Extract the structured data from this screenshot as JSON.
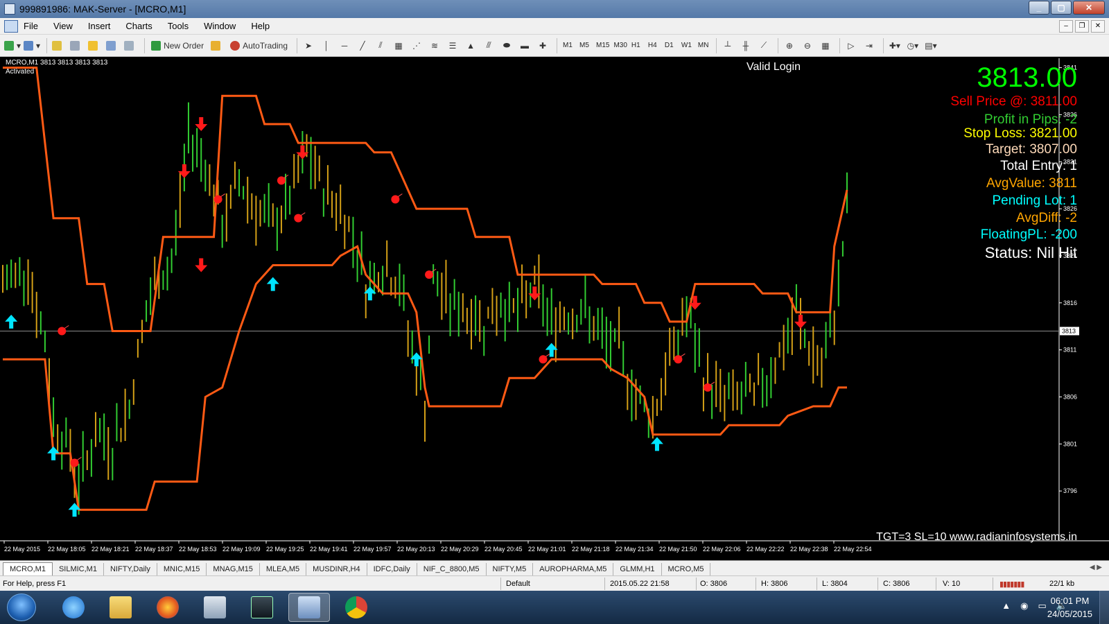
{
  "window": {
    "title": "999891986: MAK-Server - [MCRO,M1]"
  },
  "menu": [
    "File",
    "View",
    "Insert",
    "Charts",
    "Tools",
    "Window",
    "Help"
  ],
  "toolbar": {
    "new_order": "New Order",
    "autotrading": "AutoTrading",
    "timeframes": [
      "M1",
      "M5",
      "M15",
      "M30",
      "H1",
      "H4",
      "D1",
      "W1",
      "MN"
    ]
  },
  "chart": {
    "symbol_label": "MCRO,M1",
    "ohlc_label": "3813 3813 3813 3813",
    "activated_label": "Activated",
    "valid_login": "Valid Login",
    "current_price_label": "3813",
    "footer_note": "TGT=3 SL=10 www.radianinfosystems.in",
    "info_panel": [
      {
        "text": "3813.00",
        "color": "#00ff00",
        "size": 40
      },
      {
        "text": "Sell Price @: 3811.00",
        "color": "#ff0000",
        "size": 19
      },
      {
        "text": "Profit in Pips: -2",
        "color": "#32cd32",
        "size": 19
      },
      {
        "text": "Stop Loss: 3821.00",
        "color": "#ffff00",
        "size": 19
      },
      {
        "text": "Target: 3807.00",
        "color": "#ffdab9",
        "size": 19
      },
      {
        "text": "Total Entry: 1",
        "color": "#ffffff",
        "size": 19
      },
      {
        "text": "AvgValue: 3811",
        "color": "#ffa500",
        "size": 19
      },
      {
        "text": "Pending Lot: 1",
        "color": "#00ffff",
        "size": 19
      },
      {
        "text": "AvgDiff: -2",
        "color": "#ffa500",
        "size": 19
      },
      {
        "text": "FloatingPL: -200",
        "color": "#00ffff",
        "size": 19
      },
      {
        "text": "Status: Nil Hit",
        "color": "#ffffff",
        "size": 22
      }
    ]
  },
  "chart_data": {
    "type": "bar",
    "ylim": [
      3791,
      3842
    ],
    "y_ticks": [
      3841,
      3836,
      3831,
      3826,
      3821,
      3816,
      3811,
      3806,
      3801,
      3796
    ],
    "current_price": 3813,
    "x_ticks": [
      "22 May 2015",
      "22 May 18:05",
      "22 May 18:21",
      "22 May 18:37",
      "22 May 18:53",
      "22 May 19:09",
      "22 May 19:25",
      "22 May 19:41",
      "22 May 19:57",
      "22 May 20:13",
      "22 May 20:29",
      "22 May 20:45",
      "22 May 21:01",
      "22 May 21:18",
      "22 May 21:34",
      "22 May 21:50",
      "22 May 22:06",
      "22 May 22:22",
      "22 May 22:38",
      "22 May 22:54"
    ],
    "upper_band": [
      [
        0,
        3841
      ],
      [
        8,
        3841
      ],
      [
        12,
        3825
      ],
      [
        18,
        3825
      ],
      [
        20,
        3818
      ],
      [
        24,
        3818
      ],
      [
        26,
        3813
      ],
      [
        35,
        3813
      ],
      [
        38,
        3823
      ],
      [
        50,
        3823
      ],
      [
        52,
        3838
      ],
      [
        60,
        3838
      ],
      [
        62,
        3835
      ],
      [
        68,
        3835
      ],
      [
        70,
        3833
      ],
      [
        86,
        3833
      ],
      [
        88,
        3832
      ],
      [
        92,
        3832
      ],
      [
        94,
        3830
      ],
      [
        98,
        3826
      ],
      [
        110,
        3826
      ],
      [
        112,
        3823
      ],
      [
        120,
        3823
      ],
      [
        122,
        3819
      ],
      [
        140,
        3819
      ],
      [
        142,
        3818
      ],
      [
        150,
        3818
      ],
      [
        152,
        3816
      ],
      [
        156,
        3816
      ],
      [
        158,
        3814
      ],
      [
        162,
        3814
      ],
      [
        164,
        3818
      ],
      [
        178,
        3818
      ],
      [
        180,
        3817
      ],
      [
        186,
        3817
      ],
      [
        188,
        3815
      ],
      [
        196,
        3815
      ],
      [
        197,
        3822
      ],
      [
        200,
        3828
      ]
    ],
    "lower_band": [
      [
        0,
        3810
      ],
      [
        10,
        3810
      ],
      [
        12,
        3800
      ],
      [
        16,
        3800
      ],
      [
        18,
        3794
      ],
      [
        34,
        3794
      ],
      [
        36,
        3797
      ],
      [
        46,
        3797
      ],
      [
        48,
        3806
      ],
      [
        52,
        3807
      ],
      [
        56,
        3813
      ],
      [
        60,
        3818
      ],
      [
        64,
        3820
      ],
      [
        78,
        3820
      ],
      [
        80,
        3821
      ],
      [
        84,
        3822
      ],
      [
        86,
        3819
      ],
      [
        90,
        3817
      ],
      [
        96,
        3817
      ],
      [
        98,
        3815
      ],
      [
        100,
        3807
      ],
      [
        101,
        3805
      ],
      [
        118,
        3805
      ],
      [
        120,
        3808
      ],
      [
        126,
        3808
      ],
      [
        130,
        3810
      ],
      [
        142,
        3810
      ],
      [
        144,
        3809
      ],
      [
        148,
        3808
      ],
      [
        152,
        3806
      ],
      [
        154,
        3802
      ],
      [
        170,
        3802
      ],
      [
        172,
        3803
      ],
      [
        184,
        3803
      ],
      [
        186,
        3804
      ],
      [
        192,
        3805
      ],
      [
        196,
        3805
      ],
      [
        198,
        3807
      ],
      [
        200,
        3807
      ]
    ],
    "markers": {
      "buy": [
        [
          2,
          3814
        ],
        [
          12,
          3800
        ],
        [
          17,
          3794
        ],
        [
          64,
          3818
        ],
        [
          87,
          3817
        ],
        [
          98,
          3810
        ],
        [
          130,
          3811
        ],
        [
          155,
          3801
        ]
      ],
      "sell": [
        [
          47,
          3820
        ],
        [
          43,
          3830
        ],
        [
          47,
          3835
        ],
        [
          71,
          3832
        ],
        [
          126,
          3817
        ],
        [
          164,
          3816
        ],
        [
          189,
          3814
        ]
      ],
      "exit": [
        [
          14,
          3813
        ],
        [
          17,
          3799
        ],
        [
          51,
          3827
        ],
        [
          66,
          3829
        ],
        [
          70,
          3825
        ],
        [
          93,
          3827
        ],
        [
          101,
          3819
        ],
        [
          128,
          3810
        ],
        [
          160,
          3810
        ],
        [
          167,
          3807
        ]
      ]
    },
    "bar_price_path": [
      [
        0,
        3818
      ],
      [
        6,
        3820
      ],
      [
        8,
        3815
      ],
      [
        10,
        3812
      ],
      [
        12,
        3804
      ],
      [
        16,
        3800
      ],
      [
        18,
        3797
      ],
      [
        22,
        3802
      ],
      [
        26,
        3801
      ],
      [
        30,
        3805
      ],
      [
        33,
        3813
      ],
      [
        36,
        3818
      ],
      [
        40,
        3820
      ],
      [
        44,
        3834
      ],
      [
        48,
        3831
      ],
      [
        52,
        3824
      ],
      [
        56,
        3829
      ],
      [
        60,
        3826
      ],
      [
        64,
        3824
      ],
      [
        68,
        3827
      ],
      [
        72,
        3832
      ],
      [
        76,
        3828
      ],
      [
        80,
        3826
      ],
      [
        84,
        3822
      ],
      [
        86,
        3818
      ],
      [
        90,
        3820
      ],
      [
        94,
        3818
      ],
      [
        96,
        3813
      ],
      [
        98,
        3809
      ],
      [
        100,
        3805
      ],
      [
        102,
        3818
      ],
      [
        106,
        3816
      ],
      [
        110,
        3815
      ],
      [
        114,
        3814
      ],
      [
        118,
        3816
      ],
      [
        122,
        3815
      ],
      [
        126,
        3818
      ],
      [
        130,
        3814
      ],
      [
        134,
        3815
      ],
      [
        138,
        3815
      ],
      [
        142,
        3812
      ],
      [
        146,
        3811
      ],
      [
        150,
        3806
      ],
      [
        154,
        3804
      ],
      [
        158,
        3810
      ],
      [
        162,
        3815
      ],
      [
        166,
        3808
      ],
      [
        170,
        3806
      ],
      [
        174,
        3806
      ],
      [
        178,
        3806
      ],
      [
        182,
        3809
      ],
      [
        186,
        3812
      ],
      [
        188,
        3815
      ],
      [
        190,
        3812
      ],
      [
        194,
        3809
      ],
      [
        196,
        3812
      ],
      [
        198,
        3818
      ],
      [
        200,
        3826
      ]
    ]
  },
  "tabs": [
    "MCRO,M1",
    "SILMIC,M1",
    "NIFTY,Daily",
    "MNIC,M15",
    "MNAG,M15",
    "MLEA,M5",
    "MUSDINR,H4",
    "IDFC,Daily",
    "NIF_C_8800,M5",
    "NIFTY,M5",
    "AUROPHARMA,M5",
    "GLMM,H1",
    "MCRO,M5"
  ],
  "status": {
    "help": "For Help, press F1",
    "profile": "Default",
    "datetime": "2015.05.22 21:58",
    "open": "O: 3806",
    "high": "H: 3806",
    "low": "L: 3804",
    "close": "C: 3806",
    "volume": "V: 10",
    "traffic": "22/1 kb"
  },
  "taskbar": {
    "time": "06:01 PM",
    "date": "24/05/2015"
  }
}
